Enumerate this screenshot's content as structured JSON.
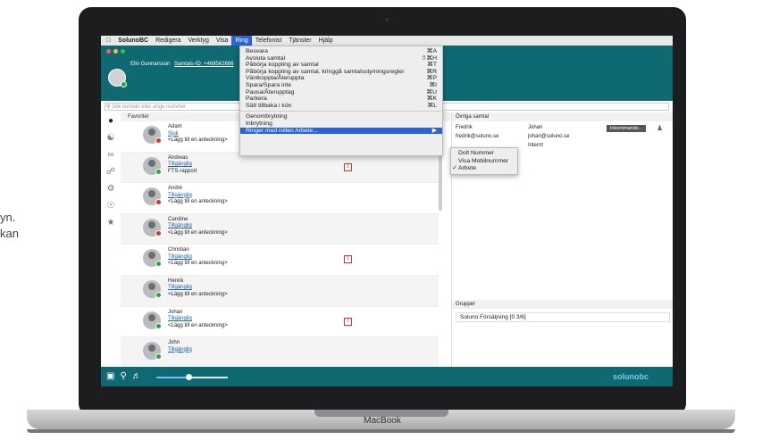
{
  "side_text": [
    "yn.",
    "kan"
  ],
  "laptop_label": "MacBook",
  "menubar": {
    "app": "SolunoBC",
    "items": [
      "Redigera",
      "Verktyg",
      "Visa",
      "Ring",
      "Telefonist",
      "Tjänster",
      "Hjälp"
    ],
    "active": "Ring"
  },
  "me": {
    "name": "Elin Gunnarsson",
    "session": "Samtals-ID: +468562686"
  },
  "search": {
    "placeholder": "Sök kontakt eller ange nummer"
  },
  "favorites_label": "Favoriter",
  "contacts": [
    {
      "name": "Adam",
      "status": "Sjuk",
      "note": "<Lägg till en anteckning>",
      "state_color": "#d9342b",
      "cal": false
    },
    {
      "name": "Andreas",
      "status": "Tillgänglig",
      "note": "FTS-rapport",
      "state_color": "#2ea043",
      "cal": true
    },
    {
      "name": "André",
      "status": "Tillgänglig",
      "note": "<Lägg till en anteckning>",
      "state_color": "#d9342b",
      "cal": false
    },
    {
      "name": "Caroline",
      "status": "Tillgänglig",
      "note": "<Lägg till en anteckning>",
      "state_color": "#d9342b",
      "cal": false
    },
    {
      "name": "Christian",
      "status": "Tillgänglig",
      "note": "<Lägg till en anteckning>",
      "state_color": "#2ea043",
      "cal": true
    },
    {
      "name": "Henrik",
      "status": "Tillgänglig",
      "note": "<Lägg till en anteckning>",
      "state_color": "#2ea043",
      "cal": false
    },
    {
      "name": "Johan",
      "status": "Tillgänglig",
      "note": "<Lägg till en anteckning>",
      "state_color": "#2ea043",
      "cal": true
    },
    {
      "name": "John",
      "status": "Tillgänglig",
      "note": "",
      "state_color": "#2ea043",
      "cal": false
    }
  ],
  "cal_glyph": "1",
  "right_panel": {
    "header": "Övriga samtal",
    "rows": [
      [
        "Fredrik",
        "Johan"
      ],
      [
        "fredrik@soluno.se",
        "johan@soluno.se"
      ],
      [
        "",
        "Internt"
      ]
    ],
    "incoming_button": "Inkommande...",
    "groups_header": "Grupper",
    "group_item": "Soluno Försäljning [0 3/6]"
  },
  "ring_menu": [
    {
      "label": "Besvara",
      "key": "⌘A"
    },
    {
      "label": "Avsluta samtal",
      "key": "⇧⌘H"
    },
    {
      "label": "Påbörja koppling av samtal",
      "key": "⌘T"
    },
    {
      "label": "Påbörja koppling av samtal, kringgå samtalsstyrningsregler",
      "key": "⌘R"
    },
    {
      "label": "Väntkoppla/Återuppta",
      "key": "⌘P"
    },
    {
      "label": "Spara/Spara inte",
      "key": "⌘I"
    },
    {
      "label": "Pausa/Återupptag",
      "key": "⌘U"
    },
    {
      "label": "Parkera",
      "key": "⌘K"
    },
    {
      "label": "Sätt tillbaka i kön",
      "key": "⌘L"
    }
  ],
  "ring_menu_2": [
    {
      "label": "Genombrytning",
      "key": ""
    },
    {
      "label": "Inbrytning",
      "key": ""
    }
  ],
  "ring_menu_highlight": {
    "label": "Ringer med rollen Arbete...",
    "key": "▶"
  },
  "submenu": [
    {
      "label": "Dolt Nummer",
      "checked": false
    },
    {
      "label": "Visa Mobilnummer",
      "checked": false
    },
    {
      "label": "Arbete",
      "checked": true
    }
  ],
  "check_glyph": "✓",
  "volume_level": 0.45,
  "brand": "solunobc"
}
